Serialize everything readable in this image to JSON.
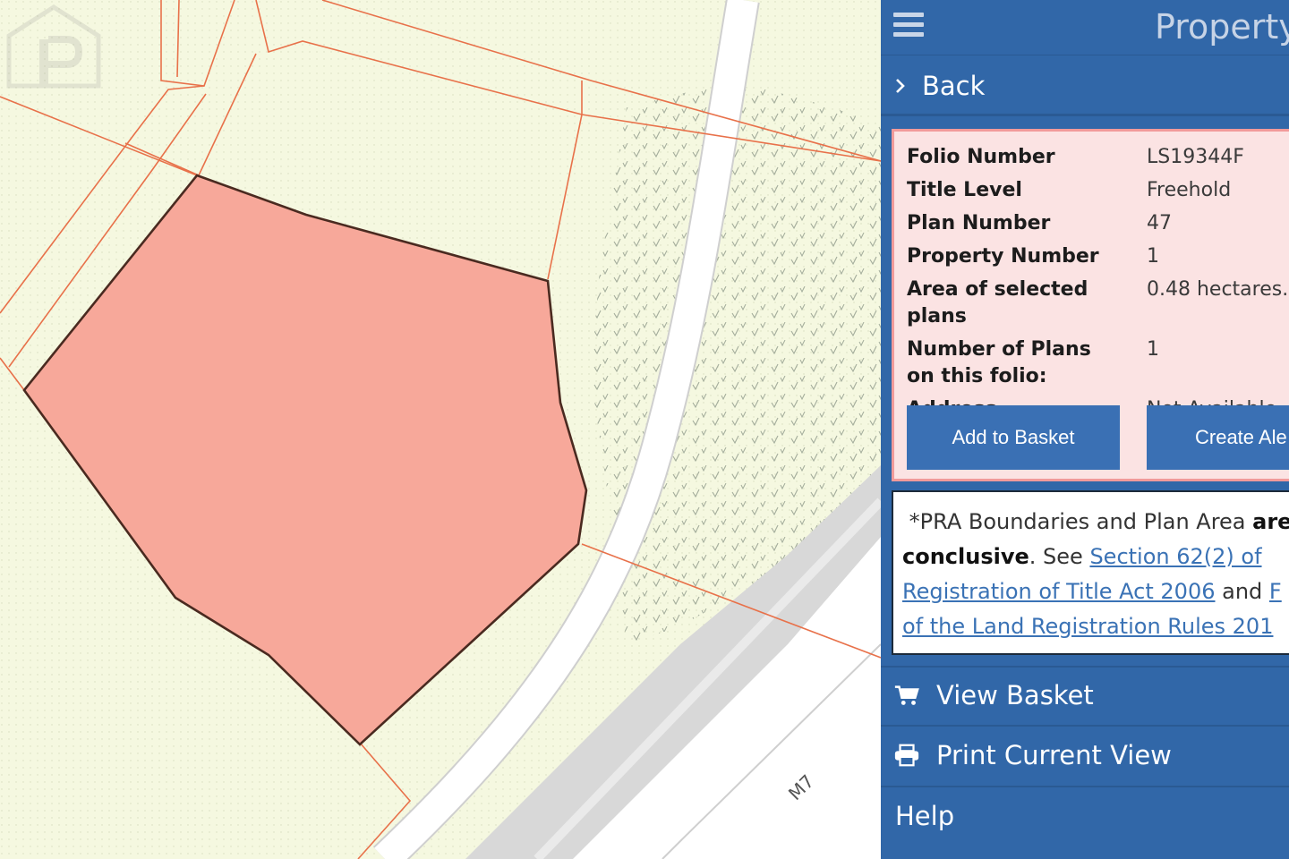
{
  "panel": {
    "title": "Property",
    "back_label": "Back",
    "icons": {
      "menu": "hamburger-menu-icon",
      "back": "chevron-right-icon",
      "basket": "shopping-cart-icon",
      "print": "printer-icon"
    }
  },
  "folio": {
    "rows": [
      {
        "label": "Folio Number",
        "value": "LS19344F"
      },
      {
        "label": "Title Level",
        "value": "Freehold"
      },
      {
        "label": "Plan Number",
        "value": "47"
      },
      {
        "label": "Property Number",
        "value": "1"
      },
      {
        "label": "Area of selected plans",
        "value": "0.48 hectares."
      },
      {
        "label": "Number of Plans on this folio:",
        "value": "1"
      },
      {
        "label": "Address",
        "value": "Not Available"
      }
    ],
    "add_to_basket_label": "Add to Basket",
    "create_alert_label": "Create Ale"
  },
  "notice": {
    "prefix": "*PRA Boundaries and Plan Area ",
    "bold1": "are no",
    "bold2": "conclusive",
    "see": ". See ",
    "link1_line1": "Section 62(2) of",
    "link1_line2": "Registration of Title Act 2006",
    "and": " and ",
    "link2_start": "F",
    "link2_line2": "of the Land Registration Rules 201"
  },
  "menu": {
    "view_basket_label": "View Basket",
    "print_label": "Print Current View",
    "help_label": "Help"
  },
  "map": {
    "road_label": "M7",
    "colors": {
      "background": "#f5f8e0",
      "boundary": "#e8714a",
      "selected_fill": "#f7a89a",
      "selected_outline": "#4a2a20",
      "road": "#ffffff",
      "road_edge": "#cfcfcf"
    }
  },
  "colors": {
    "panel_bg": "#3167a8",
    "info_bg": "#fbe3e3",
    "info_border": "#f19a9a",
    "button_bg": "#3a70b4",
    "link": "#3a72b5"
  }
}
